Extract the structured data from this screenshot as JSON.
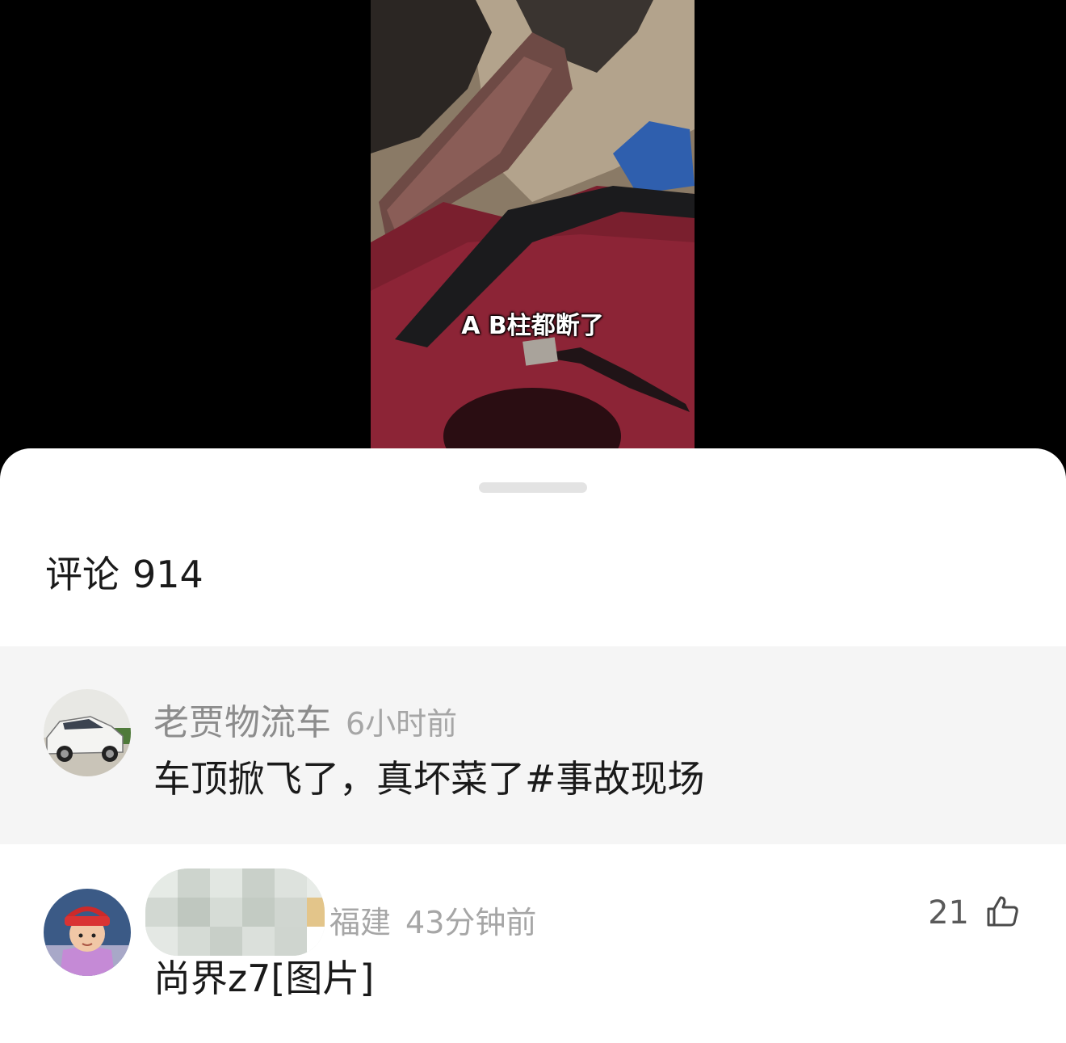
{
  "video": {
    "subtitle": "A B柱都断了"
  },
  "comments_panel": {
    "title_label": "评论",
    "title_count": "914",
    "comments": [
      {
        "username": "老贾物流车",
        "time": "6小时前",
        "text": "车顶掀飞了，真坏菜了#事故现场"
      },
      {
        "username": "",
        "location": "福建",
        "time": "43分钟前",
        "text": "尚界z7[图片]",
        "likes": "21"
      }
    ]
  },
  "icons": {
    "like": "thumbs-up-icon"
  },
  "colors": {
    "sheet_background": "#ffffff",
    "highlight_row": "#f5f5f5",
    "primary_text": "#1a1a1a",
    "secondary_text": "#8c8c8c"
  }
}
